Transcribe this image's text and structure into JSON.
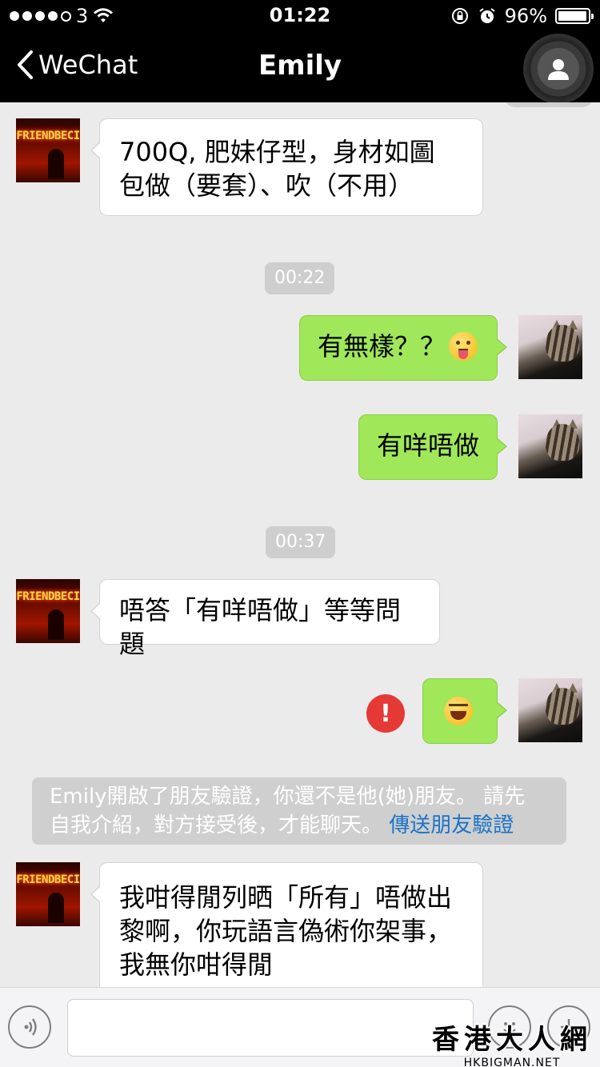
{
  "status_bar": {
    "carrier": "3",
    "time": "01:22",
    "battery_percent": "96%",
    "battery_level": 0.96
  },
  "nav": {
    "back_label": "WeChat",
    "title": "Emily",
    "profile_icon": "person-icon"
  },
  "messages": [
    {
      "from": "Emily",
      "text": "700Q, 肥妹仔型，身材如圖\n包做（要套）、吹（不用）"
    },
    {
      "timestamp": "00:22"
    },
    {
      "from": "me",
      "text": "有無樣？？"
    },
    {
      "from": "me",
      "text": "有咩唔做"
    },
    {
      "timestamp": "00:37"
    },
    {
      "from": "Emily",
      "text": "唔答「有咩唔做」等等問題"
    },
    {
      "from": "me",
      "emoji": "face-with-tears-of-joy",
      "failed": true
    },
    {
      "from": "Emily",
      "text": "我咁得閒列晒「所有」唔做出\n黎啊，你玩語言偽術你架事，\n我無你咁得閒"
    }
  ],
  "system_notice": {
    "text_line1": "Emily開啟了朋友驗證，你還不是他(她)朋友。 請先",
    "text_line2": "自我介紹，對方接受後，才能聊天。 ",
    "link": "傳送朋友驗證"
  },
  "timestamps": [
    "00:22",
    "00:37"
  ],
  "watermark": {
    "title": "香港大人網",
    "url": "HKBIGMAN.NET"
  },
  "colors": {
    "incoming_bubble": "#ffffff",
    "outgoing_bubble": "#a0e75a",
    "link": "#1a73c9",
    "error": "#e53935"
  }
}
